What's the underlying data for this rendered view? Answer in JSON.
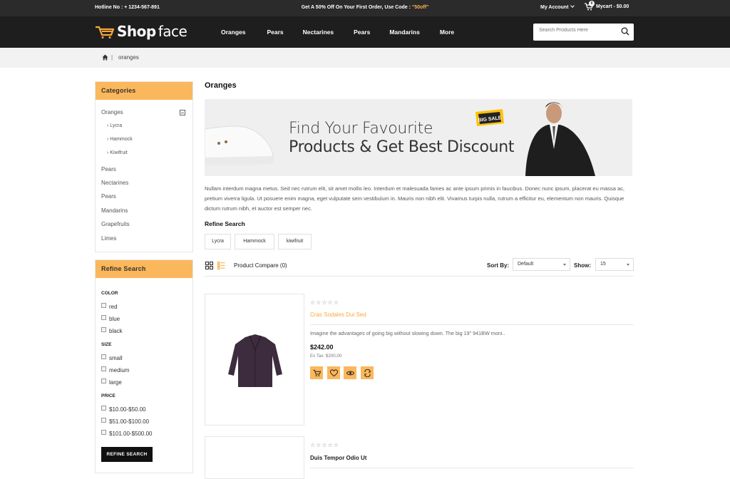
{
  "topbar": {
    "hotline": "Hotline No : + 1234-567-891",
    "promo_text": "Get A 50% Off On Your First Order, Use Code : ",
    "promo_code": "\"50off\"",
    "account_label": "My Account",
    "cart_count": "0",
    "cart_label": "Mycart - $0.00"
  },
  "header": {
    "logo_bold": "Shop",
    "logo_light": "face",
    "nav": [
      "Oranges",
      "Pears",
      "Nectarines",
      "Pears",
      "Mandarins",
      "More"
    ],
    "search_placeholder": "Search Products Here"
  },
  "breadcrumb": {
    "current": "oranges"
  },
  "sidebar": {
    "categories_title": "Categories",
    "categories": [
      {
        "label": "Oranges",
        "children": [
          "Lycra",
          "Hammock",
          "Kiwifruit"
        ]
      },
      {
        "label": "Pears"
      },
      {
        "label": "Nectarines"
      },
      {
        "label": "Pears"
      },
      {
        "label": "Mandarins"
      },
      {
        "label": "Grapefruits"
      },
      {
        "label": "Limes"
      }
    ],
    "refine_title": "Refine Search",
    "filters": [
      {
        "title": "COLOR",
        "options": [
          "red",
          "blue",
          "black"
        ]
      },
      {
        "title": "SIZE",
        "options": [
          "small",
          "medium",
          "large"
        ]
      },
      {
        "title": "PRICE",
        "options": [
          "$10.00-$50.00",
          "$51.00-$100.00",
          "$101.00-$500.00"
        ]
      }
    ],
    "refine_button": "REFINE SEARCH"
  },
  "main": {
    "title": "Oranges",
    "banner": {
      "line1": "Find Your Favourite",
      "line2": "Products & Get Best Discount",
      "badge": "BIG SALE"
    },
    "description": "Nullam interdum magna metus. Sed nec rutrum elit, sit amet mollis leo. Interdum et malesuada fames ac ante ipsum primis in faucibus. Donec nunc ipsum, placerat eu massa ac, pretium viverra ligula. Ut posuere enim magna, eget vulputate sem vestibulum in. Mauris non nibh elit. Vivamus turpis nulla, rutrum a efficitur eu, elementum non mauris. Quisque dictum rutrum nibh, et auctor est semper nec.",
    "refine_heading": "Refine Search",
    "chips": [
      "Lycra",
      "Hammock",
      "kiwifruit"
    ],
    "compare": "Product Compare (0)",
    "sort_label": "Sort By:",
    "sort_value": "Default",
    "show_label": "Show:",
    "show_value": "15",
    "products": [
      {
        "name": "Cras Sodales Dui Sed",
        "name_color": "#f7a93b",
        "stars": "☆☆☆☆☆",
        "desc": "Imagine the advantages of going big without slowing down. The big 19\" 941BW moni..",
        "price": "$242.00",
        "extax": "Ex Tax: $200,00"
      },
      {
        "name": "Duis Tempor Odio Ut",
        "name_color": "#222222",
        "stars": "☆☆☆☆☆"
      }
    ]
  },
  "colors": {
    "accent": "#fbb75b",
    "topbar": "#2b2b2b",
    "header": "#1e1e1e"
  }
}
